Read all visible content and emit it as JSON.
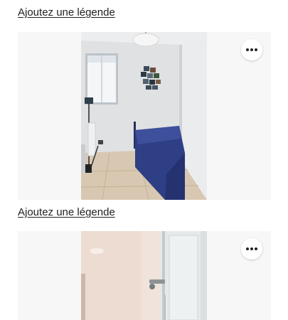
{
  "photos": [
    {
      "caption_link": "Ajoutez une légende",
      "options_icon": "ellipsis-horizontal-icon",
      "image": "bedroom-photo"
    },
    {
      "caption_link": "Ajoutez une légende",
      "options_icon": "ellipsis-horizontal-icon",
      "image": "bathroom-photo"
    }
  ],
  "colors": {
    "text": "#222222",
    "card_background": "#f7f7f7",
    "button_background": "#ffffff"
  }
}
